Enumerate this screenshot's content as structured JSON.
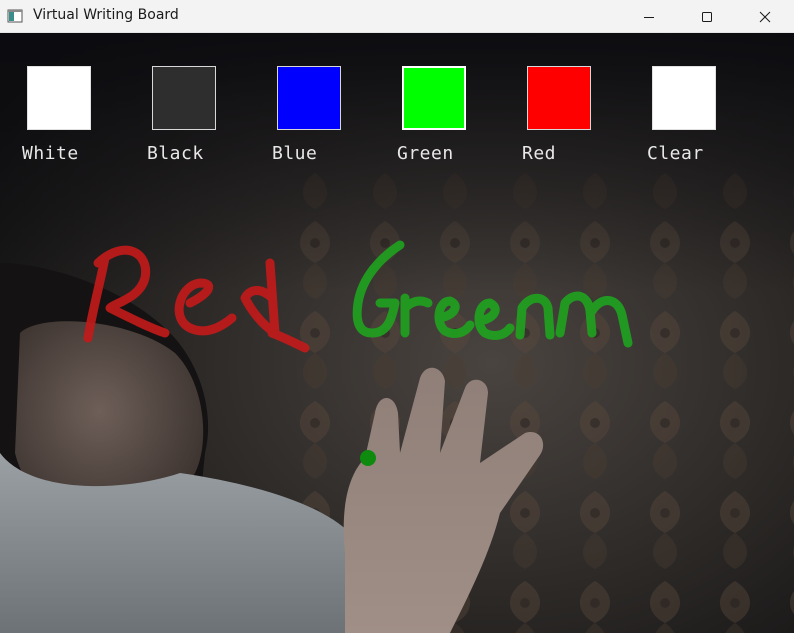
{
  "window": {
    "title": "Virtual Writing Board",
    "controls": {
      "minimize": "minimize",
      "maximize": "maximize",
      "close": "close"
    }
  },
  "palette": [
    {
      "label": "White",
      "color": "#ffffff"
    },
    {
      "label": "Black",
      "color": "#2e2e2e"
    },
    {
      "label": "Blue",
      "color": "#0000ff"
    },
    {
      "label": "Green",
      "color": "#00ff00"
    },
    {
      "label": "Red",
      "color": "#ff0000"
    },
    {
      "label": "Clear",
      "color": "#ffffff"
    }
  ],
  "selected_color": "Green",
  "drawing": {
    "strokes": [
      {
        "color": "#c41a1a",
        "word": "Red"
      },
      {
        "color": "#1fa31f",
        "word": "Green"
      }
    ],
    "cursor_color": "#0e8a0e"
  },
  "colors": {
    "titlebar_bg": "#f3f3f3",
    "label_text": "#e8e8e8"
  }
}
